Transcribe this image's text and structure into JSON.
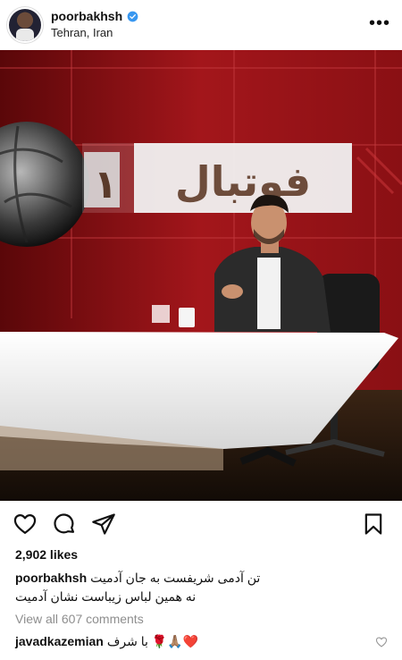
{
  "post": {
    "username": "poorbakhsh",
    "location": "Tehran, Iran",
    "verified": true,
    "more_label": "•••"
  },
  "photo": {
    "backdrop_text": "فوتبال",
    "backdrop_number": "۱",
    "colors": {
      "red": "#9b1418",
      "dark_red": "#6a0a0d",
      "desk": "#f2f2f2",
      "floor": "#2a1b12"
    }
  },
  "actions": {
    "like_icon": "heart-icon",
    "comment_icon": "comment-icon",
    "share_icon": "share-icon",
    "save_icon": "bookmark-icon"
  },
  "likes": "2,902 likes",
  "caption": {
    "username": "poorbakhsh",
    "line1": "تن آدمی شریفست به جان آدمیت",
    "line2": "نه همین لباس زیباست نشان آدمیت"
  },
  "view_comments": "View all 607 comments",
  "comments": [
    {
      "username": "javadkazemian",
      "text": "با شرف 🌹🙏🏽❤️"
    }
  ]
}
